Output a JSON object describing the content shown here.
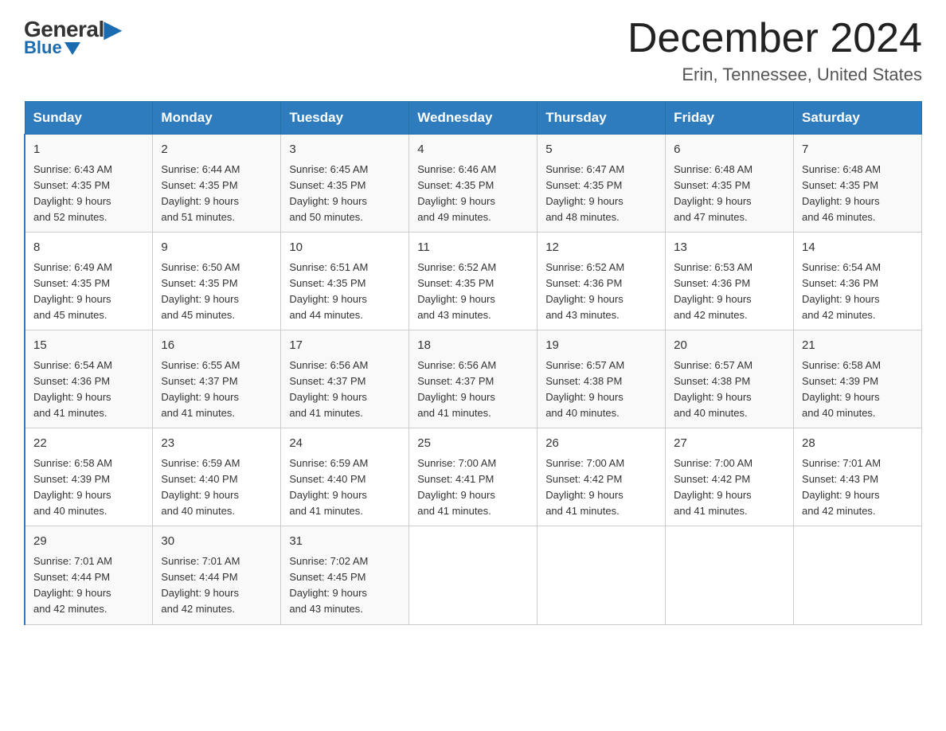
{
  "header": {
    "logo_general": "General",
    "logo_blue": "Blue",
    "title": "December 2024",
    "subtitle": "Erin, Tennessee, United States"
  },
  "weekdays": [
    "Sunday",
    "Monday",
    "Tuesday",
    "Wednesday",
    "Thursday",
    "Friday",
    "Saturday"
  ],
  "weeks": [
    [
      {
        "day": "1",
        "sunrise": "6:43 AM",
        "sunset": "4:35 PM",
        "daylight": "9 hours and 52 minutes."
      },
      {
        "day": "2",
        "sunrise": "6:44 AM",
        "sunset": "4:35 PM",
        "daylight": "9 hours and 51 minutes."
      },
      {
        "day": "3",
        "sunrise": "6:45 AM",
        "sunset": "4:35 PM",
        "daylight": "9 hours and 50 minutes."
      },
      {
        "day": "4",
        "sunrise": "6:46 AM",
        "sunset": "4:35 PM",
        "daylight": "9 hours and 49 minutes."
      },
      {
        "day": "5",
        "sunrise": "6:47 AM",
        "sunset": "4:35 PM",
        "daylight": "9 hours and 48 minutes."
      },
      {
        "day": "6",
        "sunrise": "6:48 AM",
        "sunset": "4:35 PM",
        "daylight": "9 hours and 47 minutes."
      },
      {
        "day": "7",
        "sunrise": "6:48 AM",
        "sunset": "4:35 PM",
        "daylight": "9 hours and 46 minutes."
      }
    ],
    [
      {
        "day": "8",
        "sunrise": "6:49 AM",
        "sunset": "4:35 PM",
        "daylight": "9 hours and 45 minutes."
      },
      {
        "day": "9",
        "sunrise": "6:50 AM",
        "sunset": "4:35 PM",
        "daylight": "9 hours and 45 minutes."
      },
      {
        "day": "10",
        "sunrise": "6:51 AM",
        "sunset": "4:35 PM",
        "daylight": "9 hours and 44 minutes."
      },
      {
        "day": "11",
        "sunrise": "6:52 AM",
        "sunset": "4:35 PM",
        "daylight": "9 hours and 43 minutes."
      },
      {
        "day": "12",
        "sunrise": "6:52 AM",
        "sunset": "4:36 PM",
        "daylight": "9 hours and 43 minutes."
      },
      {
        "day": "13",
        "sunrise": "6:53 AM",
        "sunset": "4:36 PM",
        "daylight": "9 hours and 42 minutes."
      },
      {
        "day": "14",
        "sunrise": "6:54 AM",
        "sunset": "4:36 PM",
        "daylight": "9 hours and 42 minutes."
      }
    ],
    [
      {
        "day": "15",
        "sunrise": "6:54 AM",
        "sunset": "4:36 PM",
        "daylight": "9 hours and 41 minutes."
      },
      {
        "day": "16",
        "sunrise": "6:55 AM",
        "sunset": "4:37 PM",
        "daylight": "9 hours and 41 minutes."
      },
      {
        "day": "17",
        "sunrise": "6:56 AM",
        "sunset": "4:37 PM",
        "daylight": "9 hours and 41 minutes."
      },
      {
        "day": "18",
        "sunrise": "6:56 AM",
        "sunset": "4:37 PM",
        "daylight": "9 hours and 41 minutes."
      },
      {
        "day": "19",
        "sunrise": "6:57 AM",
        "sunset": "4:38 PM",
        "daylight": "9 hours and 40 minutes."
      },
      {
        "day": "20",
        "sunrise": "6:57 AM",
        "sunset": "4:38 PM",
        "daylight": "9 hours and 40 minutes."
      },
      {
        "day": "21",
        "sunrise": "6:58 AM",
        "sunset": "4:39 PM",
        "daylight": "9 hours and 40 minutes."
      }
    ],
    [
      {
        "day": "22",
        "sunrise": "6:58 AM",
        "sunset": "4:39 PM",
        "daylight": "9 hours and 40 minutes."
      },
      {
        "day": "23",
        "sunrise": "6:59 AM",
        "sunset": "4:40 PM",
        "daylight": "9 hours and 40 minutes."
      },
      {
        "day": "24",
        "sunrise": "6:59 AM",
        "sunset": "4:40 PM",
        "daylight": "9 hours and 41 minutes."
      },
      {
        "day": "25",
        "sunrise": "7:00 AM",
        "sunset": "4:41 PM",
        "daylight": "9 hours and 41 minutes."
      },
      {
        "day": "26",
        "sunrise": "7:00 AM",
        "sunset": "4:42 PM",
        "daylight": "9 hours and 41 minutes."
      },
      {
        "day": "27",
        "sunrise": "7:00 AM",
        "sunset": "4:42 PM",
        "daylight": "9 hours and 41 minutes."
      },
      {
        "day": "28",
        "sunrise": "7:01 AM",
        "sunset": "4:43 PM",
        "daylight": "9 hours and 42 minutes."
      }
    ],
    [
      {
        "day": "29",
        "sunrise": "7:01 AM",
        "sunset": "4:44 PM",
        "daylight": "9 hours and 42 minutes."
      },
      {
        "day": "30",
        "sunrise": "7:01 AM",
        "sunset": "4:44 PM",
        "daylight": "9 hours and 42 minutes."
      },
      {
        "day": "31",
        "sunrise": "7:02 AM",
        "sunset": "4:45 PM",
        "daylight": "9 hours and 43 minutes."
      },
      null,
      null,
      null,
      null
    ]
  ],
  "labels": {
    "sunrise": "Sunrise:",
    "sunset": "Sunset:",
    "daylight": "Daylight:"
  }
}
